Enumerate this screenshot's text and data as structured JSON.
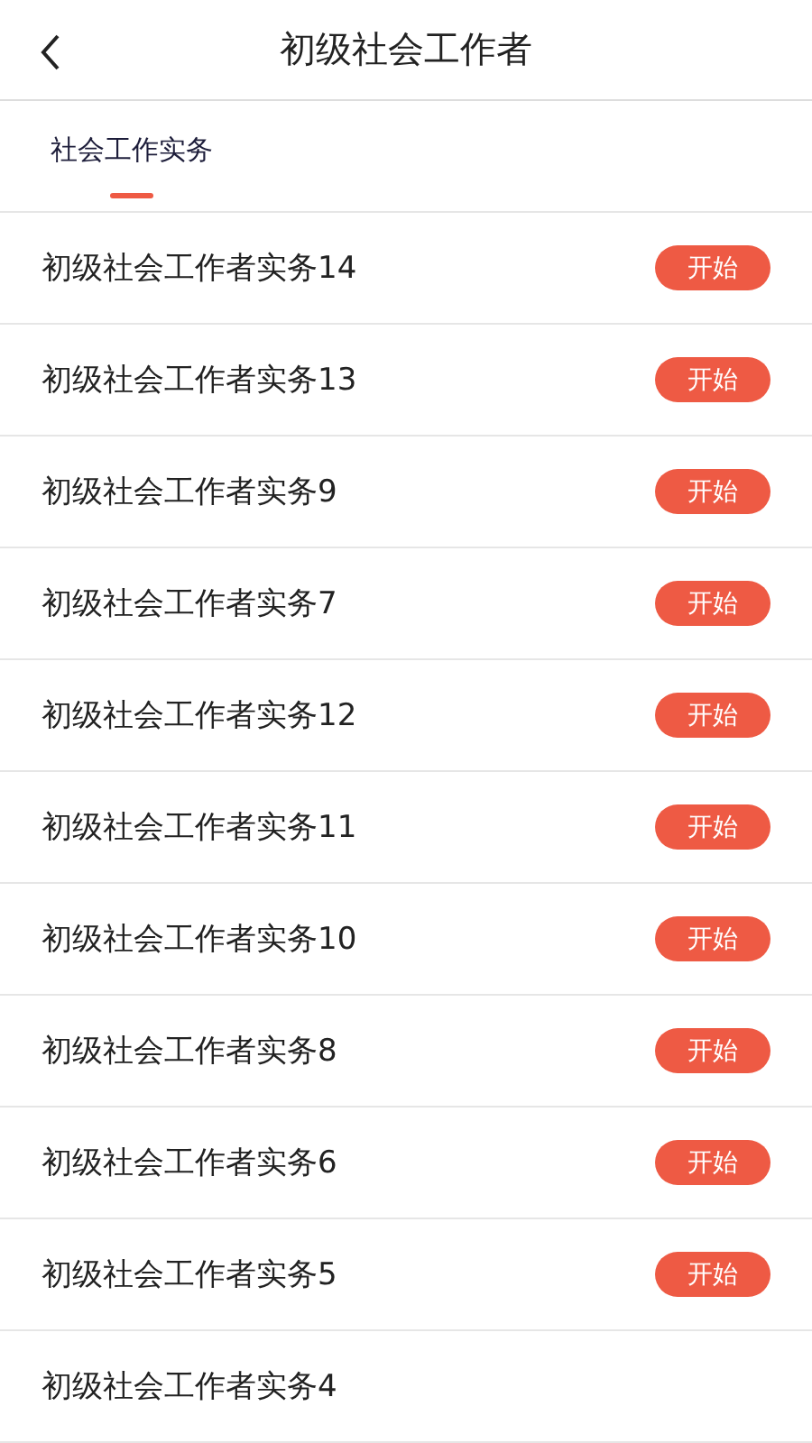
{
  "header": {
    "title": "初级社会工作者"
  },
  "tabs": [
    {
      "label": "社会工作实务",
      "selected": true
    }
  ],
  "rows": [
    {
      "title": "初级社会工作者实务14",
      "action": "开始"
    },
    {
      "title": "初级社会工作者实务13",
      "action": "开始"
    },
    {
      "title": "初级社会工作者实务9",
      "action": "开始"
    },
    {
      "title": "初级社会工作者实务7",
      "action": "开始"
    },
    {
      "title": "初级社会工作者实务12",
      "action": "开始"
    },
    {
      "title": "初级社会工作者实务11",
      "action": "开始"
    },
    {
      "title": "初级社会工作者实务10",
      "action": "开始"
    },
    {
      "title": "初级社会工作者实务8",
      "action": "开始"
    },
    {
      "title": "初级社会工作者实务6",
      "action": "开始"
    },
    {
      "title": "初级社会工作者实务5",
      "action": "开始"
    },
    {
      "title": "初级社会工作者实务4"
    }
  ]
}
